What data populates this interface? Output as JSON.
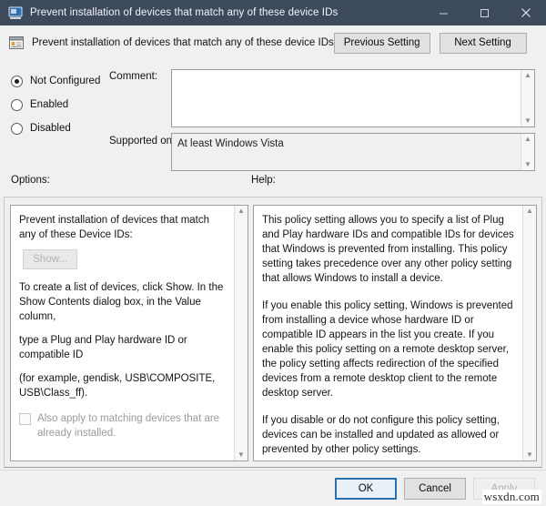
{
  "window": {
    "title": "Prevent installation of devices that match any of these device IDs",
    "icon": "policy-window-icon",
    "minimize_label": "Minimize",
    "maximize_label": "Maximize",
    "close_label": "Close"
  },
  "header": {
    "icon": "policy-setting-icon",
    "title": "Prevent installation of devices that match any of these device IDs",
    "previous_setting_label": "Previous Setting",
    "next_setting_label": "Next Setting"
  },
  "state": {
    "options": [
      {
        "label": "Not Configured",
        "selected": true
      },
      {
        "label": "Enabled",
        "selected": false
      },
      {
        "label": "Disabled",
        "selected": false
      }
    ]
  },
  "comment": {
    "label": "Comment:",
    "value": "",
    "placeholder": ""
  },
  "supported_on": {
    "label": "Supported on:",
    "value": "At least Windows Vista"
  },
  "sections": {
    "options_label": "Options:",
    "help_label": "Help:"
  },
  "options_panel": {
    "heading": "Prevent installation of devices that match any of these Device IDs:",
    "show_button_label": "Show...",
    "show_button_enabled": false,
    "instructions": [
      "To create a list of devices, click Show. In the Show Contents dialog box, in the Value column,",
      "type a Plug and Play hardware ID or compatible ID",
      "(for example, gendisk, USB\\COMPOSITE, USB\\Class_ff)."
    ],
    "checkbox": {
      "label": "Also apply to matching devices that are already installed.",
      "checked": false,
      "enabled": false
    }
  },
  "help_panel": {
    "paragraphs": [
      "This policy setting allows you to specify a list of Plug and Play hardware IDs and compatible IDs for devices that Windows is prevented from installing. This policy setting takes precedence over any other policy setting that allows Windows to install a device.",
      "If you enable this policy setting, Windows is prevented from installing a device whose hardware ID or compatible ID appears in the list you create. If you enable this policy setting on a remote desktop server, the policy setting affects redirection of the specified devices from a remote desktop client to the remote desktop server.",
      "If you disable or do not configure this policy setting, devices can be installed and updated as allowed or prevented by other policy settings."
    ]
  },
  "footer": {
    "ok_label": "OK",
    "cancel_label": "Cancel",
    "apply_label": "Apply",
    "apply_enabled": false
  },
  "watermark": {
    "text": "wsxdn.com"
  },
  "colors": {
    "titlebar_bg": "#3d4a5c",
    "dialog_bg": "#f0f0f0",
    "panel_bg": "#ffffff",
    "accent_focus": "#2a6fb0",
    "disabled_text": "#b2b2b2"
  }
}
